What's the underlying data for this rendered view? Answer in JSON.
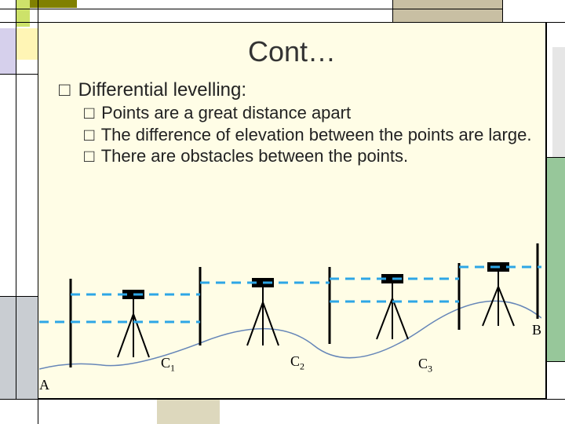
{
  "title": "Cont…",
  "main_bullet": {
    "marker": "□",
    "text": "Differential levelling:"
  },
  "sub_bullets": [
    {
      "marker": "□",
      "text": "Points are a great distance apart"
    },
    {
      "marker": "□",
      "text": "The difference of elevation between the points are large."
    },
    {
      "marker": "□",
      "text": "There are obstacles between the points."
    }
  ],
  "diagram": {
    "left_label": "A",
    "right_label": "B",
    "stations": [
      {
        "name": "C",
        "sub": "1"
      },
      {
        "name": "C",
        "sub": "2"
      },
      {
        "name": "C",
        "sub": "3"
      }
    ]
  }
}
